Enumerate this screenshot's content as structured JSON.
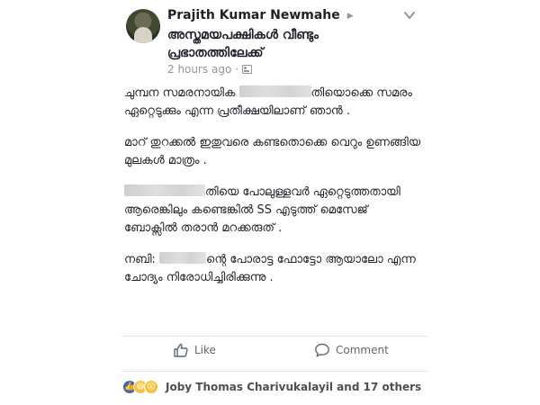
{
  "post": {
    "author": "Prajith Kumar Newmahe",
    "group": "അസ്തമയപക്ഷികൾ വീണ്ടും പ്രഭാതത്തിലേക്ക്",
    "timestamp": "2 hours ago",
    "separator": "·"
  },
  "body": {
    "p1_a": "ചുമ്പന സമരനായിക ",
    "p1_b": "തിയൊക്കെ സമരം ഏറ്റെടുക്കും എന്ന പ്രതീക്ഷയിലാണ് ഞാൻ .",
    "p2": "മാറ് തുറക്കൽ ഇതുവരെ കണ്ടതൊക്കെ വെറും ഉണങ്ങിയ മുലകൾ മാത്രം .",
    "p3_b": "തിയെ പോലുള്ളവർ  ഏറ്റെടുത്തതായി ആരെങ്കിലും കണ്ടെങ്കിൽ SS എടുത്ത് മെസേജ് ബോക്സിൽ തരാൻ മറക്കരുത് .",
    "p4_a": "നബി: ",
    "p4_b": "ന്റെ പോരാട്ട ഫോട്ടോ ആയാലോ എന്ന ചോദ്യം നിരോധിച്ചിരിക്കുന്നു ."
  },
  "actions": {
    "like_label": "Like",
    "comment_label": "Comment"
  },
  "reactions": {
    "names": "Joby Thomas Charivukalayil and 17 others"
  },
  "icons": {
    "privacy": "public-group-icon",
    "menu": "chevron-down-icon",
    "like": "thumbs-up-icon",
    "comment": "speech-bubble-icon"
  },
  "colors": {
    "like_reaction": "#4267b2",
    "emoji_reaction": "#f5c33b",
    "meta_text": "#90949c"
  }
}
